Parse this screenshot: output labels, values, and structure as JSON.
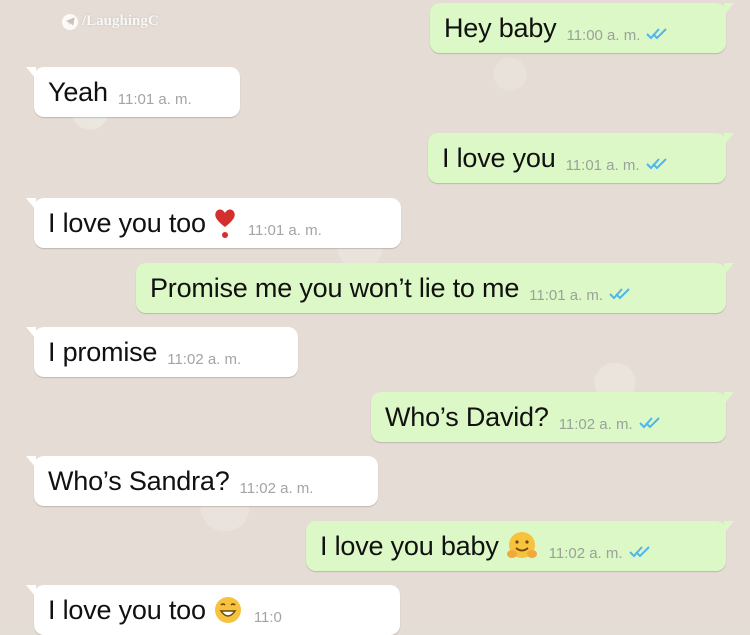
{
  "watermark": {
    "text": "/LaughingC"
  },
  "colors": {
    "incoming": "#ffffff",
    "outgoing": "#dcf8c6",
    "tick_blue": "#4fb6ec",
    "background": "#e5ddd5"
  },
  "messages": [
    {
      "dir": "out",
      "text": "Hey baby",
      "time": "11:00 a. m.",
      "status": "read"
    },
    {
      "dir": "in",
      "text": "Yeah",
      "time": "11:01 a. m."
    },
    {
      "dir": "out",
      "text": "I love you",
      "time": "11:01 a. m.",
      "status": "read"
    },
    {
      "dir": "in",
      "text": "I love you too",
      "time": "11:01 a. m.",
      "emoji": "red-exclamation-heart-icon"
    },
    {
      "dir": "out",
      "text": "Promise me you won’t lie to me",
      "time": "11:01 a. m.",
      "status": "read"
    },
    {
      "dir": "in",
      "text": "I promise",
      "time": "11:02 a. m."
    },
    {
      "dir": "out",
      "text": "Who’s David?",
      "time": "11:02 a. m.",
      "status": "read"
    },
    {
      "dir": "in",
      "text": "Who’s Sandra?",
      "time": "11:02 a. m."
    },
    {
      "dir": "out",
      "text": "I love you baby",
      "time": "11:02 a. m.",
      "status": "read",
      "emoji": "hugging-face-icon"
    },
    {
      "dir": "in",
      "text": "I love you too",
      "time": "11:0",
      "emoji": "grinning-face-icon"
    }
  ]
}
